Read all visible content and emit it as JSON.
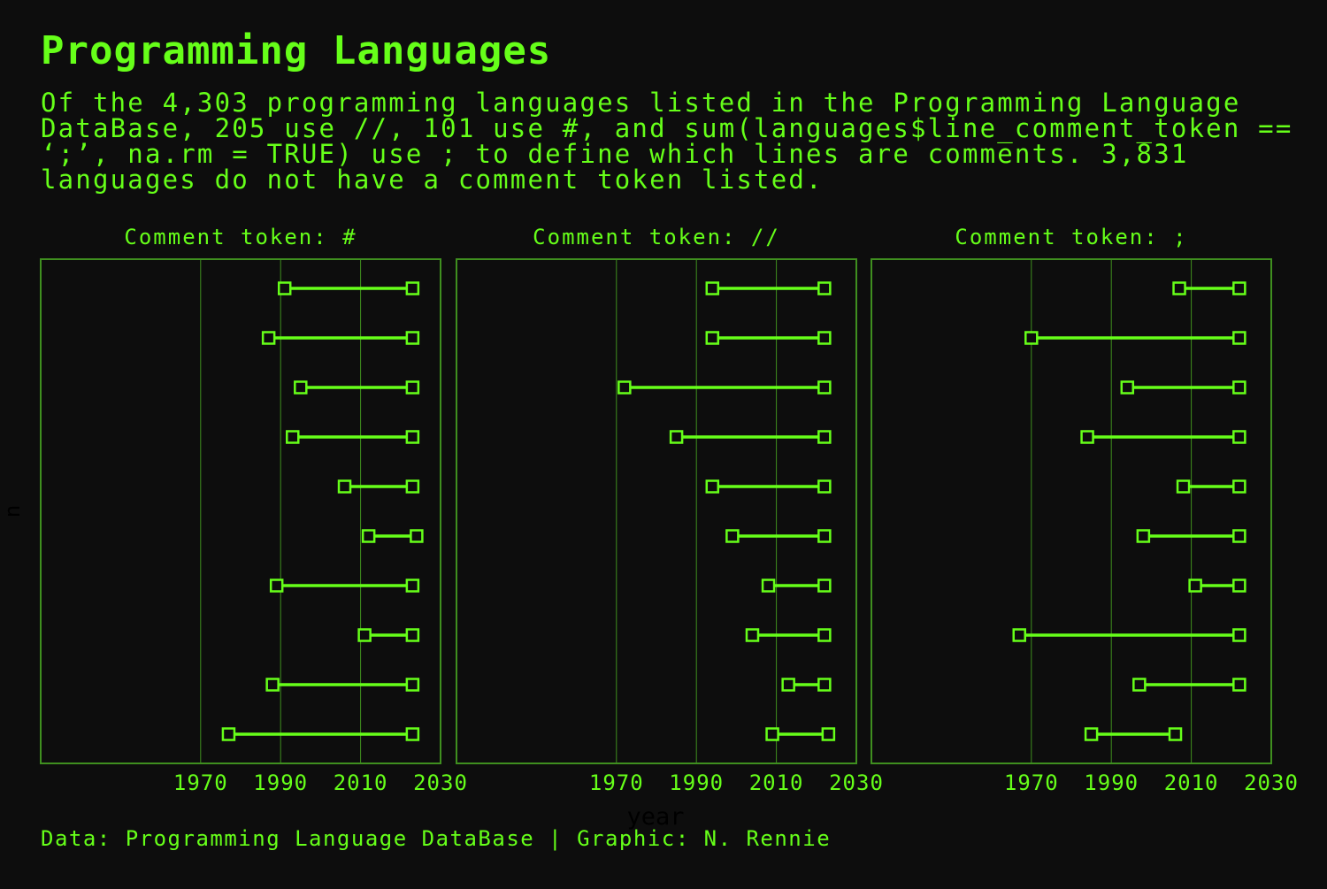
{
  "title": "Programming Languages",
  "subtitle": "Of the 4,303 programming languages listed in the Programming Language DataBase, 205 use //, 101 use #, and sum(languages$line_comment_token == ‘;’, na.rm = TRUE) use ; to define which lines are comments. 3,831 languages do not have a comment token listed.",
  "caption": "Data: Programming Language DataBase | Graphic: N. Rennie",
  "colors": {
    "background": "#0d0d0d",
    "accent": "#66ff19",
    "grid": "#3f8f1f",
    "axis_title": "#000000"
  },
  "chart_data": {
    "type": "dumbbell",
    "xlabel": "year",
    "ylabel": "n",
    "xlim": [
      1930,
      2030
    ],
    "xticks": [
      1970,
      1990,
      2010,
      2030
    ],
    "grid": "vertical major gridlines",
    "facets": [
      {
        "title": "Comment token: #",
        "rows": [
          {
            "start": 1991,
            "end": 2023
          },
          {
            "start": 1987,
            "end": 2023
          },
          {
            "start": 1995,
            "end": 2023
          },
          {
            "start": 1993,
            "end": 2023
          },
          {
            "start": 2006,
            "end": 2023
          },
          {
            "start": 2012,
            "end": 2024
          },
          {
            "start": 1989,
            "end": 2023
          },
          {
            "start": 2011,
            "end": 2023
          },
          {
            "start": 1988,
            "end": 2023
          },
          {
            "start": 1977,
            "end": 2023
          }
        ]
      },
      {
        "title": "Comment token: //",
        "rows": [
          {
            "start": 1994,
            "end": 2022
          },
          {
            "start": 1994,
            "end": 2022
          },
          {
            "start": 1972,
            "end": 2022
          },
          {
            "start": 1985,
            "end": 2022
          },
          {
            "start": 1994,
            "end": 2022
          },
          {
            "start": 1999,
            "end": 2022
          },
          {
            "start": 2008,
            "end": 2022
          },
          {
            "start": 2004,
            "end": 2022
          },
          {
            "start": 2013,
            "end": 2022
          },
          {
            "start": 2009,
            "end": 2023
          }
        ]
      },
      {
        "title": "Comment token: ;",
        "rows": [
          {
            "start": 2007,
            "end": 2022
          },
          {
            "start": 1970,
            "end": 2022
          },
          {
            "start": 1994,
            "end": 2022
          },
          {
            "start": 1984,
            "end": 2022
          },
          {
            "start": 2008,
            "end": 2022
          },
          {
            "start": 1998,
            "end": 2022
          },
          {
            "start": 2011,
            "end": 2022
          },
          {
            "start": 1967,
            "end": 2022
          },
          {
            "start": 1997,
            "end": 2022
          },
          {
            "start": 1985,
            "end": 2006
          }
        ]
      }
    ]
  }
}
